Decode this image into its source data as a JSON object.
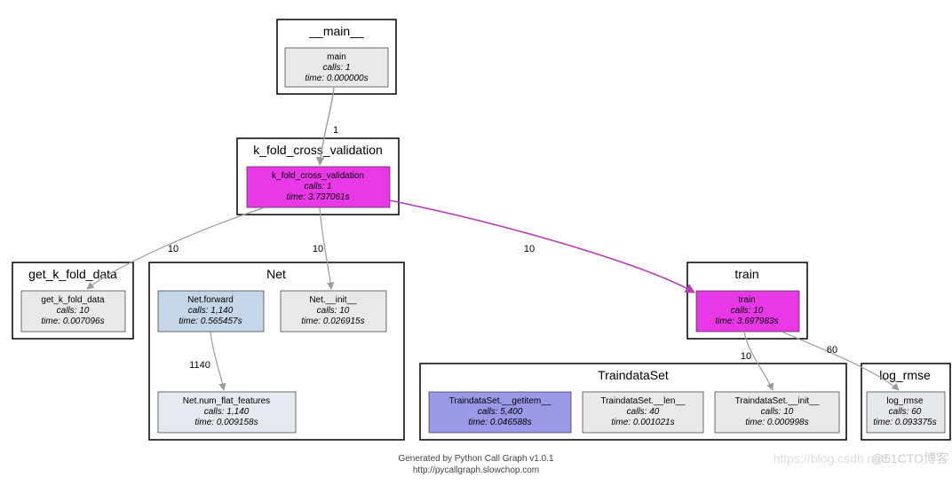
{
  "modules": {
    "main": {
      "title": "__main__"
    },
    "kfold": {
      "title": "k_fold_cross_validation"
    },
    "getkfold": {
      "title": "get_k_fold_data"
    },
    "net": {
      "title": "Net"
    },
    "train": {
      "title": "train"
    },
    "trainds": {
      "title": "TraindataSet"
    },
    "logrmse": {
      "title": "log_rmse"
    }
  },
  "nodes": {
    "main": {
      "name": "main",
      "calls": "calls: 1",
      "time": "time: 0.000000s"
    },
    "kfoldcv": {
      "name": "k_fold_cross_validation",
      "calls": "calls: 1",
      "time": "time: 3.737061s"
    },
    "getkfold": {
      "name": "get_k_fold_data",
      "calls": "calls: 10",
      "time": "time: 0.007096s"
    },
    "netforward": {
      "name": "Net.forward",
      "calls": "calls: 1,140",
      "time": "time: 0.565457s"
    },
    "netinit": {
      "name": "Net.__init__",
      "calls": "calls: 10",
      "time": "time: 0.026915s"
    },
    "netnumflat": {
      "name": "Net.num_flat_features",
      "calls": "calls: 1,140",
      "time": "time: 0.009158s"
    },
    "trainfn": {
      "name": "train",
      "calls": "calls: 10",
      "time": "time: 3.697983s"
    },
    "tdsgetitem": {
      "name": "TraindataSet.__getitem__",
      "calls": "calls: 5,400",
      "time": "time: 0.046588s"
    },
    "tdslen": {
      "name": "TraindataSet.__len__",
      "calls": "calls: 40",
      "time": "time: 0.001021s"
    },
    "tdsinit": {
      "name": "TraindataSet.__init__",
      "calls": "calls: 10",
      "time": "time: 0.000998s"
    },
    "logrmse": {
      "name": "log_rmse",
      "calls": "calls: 60",
      "time": "time: 0.093375s"
    }
  },
  "edges": {
    "main_kfold": {
      "label": "1"
    },
    "kfold_getk": {
      "label": "10"
    },
    "kfold_net": {
      "label": "10"
    },
    "kfold_train": {
      "label": "10"
    },
    "netfw_flat": {
      "label": "1140"
    },
    "train_tds": {
      "label": "10"
    },
    "train_log": {
      "label": "60"
    }
  },
  "footer": {
    "line1": "Generated by Python Call Graph v1.0.1",
    "line2": "http://pycallgraph.slowchop.com"
  },
  "watermark": {
    "text1": "https://blog.csdn.net/",
    "text2": "@51CTO博客"
  }
}
